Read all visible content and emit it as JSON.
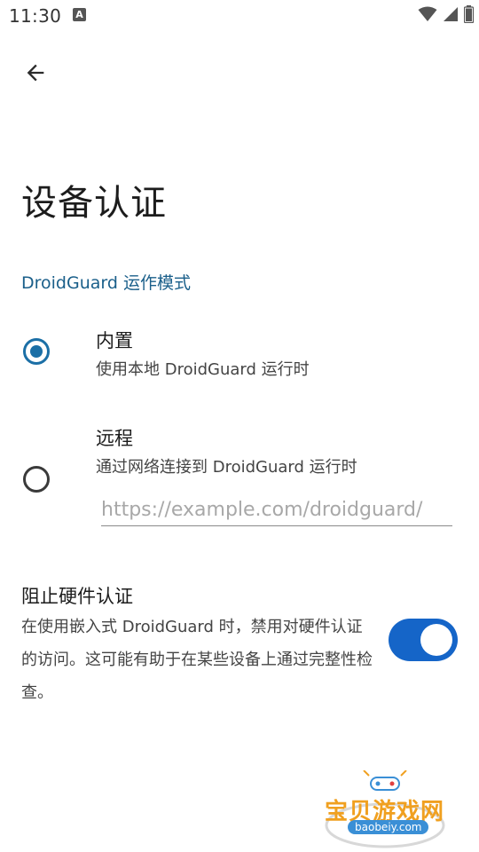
{
  "status_bar": {
    "time": "11:30",
    "notification_badge": "A",
    "icons": [
      "wifi-icon",
      "cellular-icon",
      "battery-icon"
    ]
  },
  "nav": {
    "back_icon": "arrow-back-icon"
  },
  "page": {
    "title": "设备认证"
  },
  "section": {
    "header": "DroidGuard 运作模式"
  },
  "options": [
    {
      "title": "内置",
      "subtitle": "使用本地 DroidGuard 运行时",
      "selected": true
    },
    {
      "title": "远程",
      "subtitle": "通过网络连接到 DroidGuard 运行时",
      "selected": false,
      "url_placeholder": "https://example.com/droidguard/"
    }
  ],
  "block_attestation": {
    "title": "阻止硬件认证",
    "description": "在使用嵌入式 DroidGuard 时，禁用对硬件认证的访问。这可能有助于在某些设备上通过完整性检查。",
    "enabled": true
  },
  "watermark": {
    "text": "宝贝游戏网",
    "url": "baobeiy.com"
  },
  "colors": {
    "accent": "#1b6fa6",
    "toggle_on": "#1565c8",
    "section_header": "#1a5f8a"
  }
}
